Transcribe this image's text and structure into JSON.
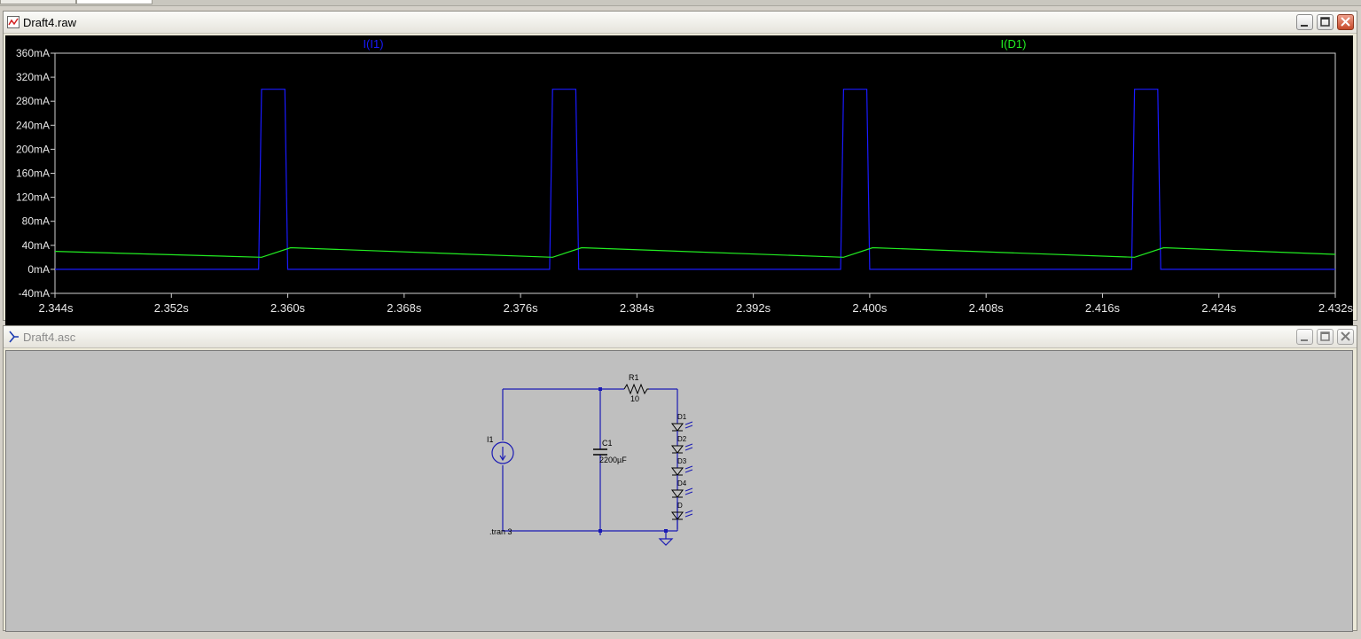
{
  "raw_window": {
    "title": "Draft4.raw",
    "icon": "waveform-icon",
    "traces": [
      {
        "name": "I(I1)",
        "color": "#1a1aff"
      },
      {
        "name": "I(D1)",
        "color": "#22ee22"
      }
    ]
  },
  "chart_data": {
    "type": "line",
    "x_unit": "s",
    "y_unit": "A",
    "xlim": [
      2.344,
      2.432
    ],
    "ylim": [
      -0.04,
      0.36
    ],
    "x_ticks": [
      "2.344s",
      "2.352s",
      "2.360s",
      "2.368s",
      "2.376s",
      "2.384s",
      "2.392s",
      "2.400s",
      "2.408s",
      "2.416s",
      "2.424s",
      "2.432s"
    ],
    "y_ticks": [
      "360mA",
      "320mA",
      "280mA",
      "240mA",
      "200mA",
      "160mA",
      "120mA",
      "80mA",
      "40mA",
      "0mA",
      "-40mA"
    ],
    "series": [
      {
        "name": "I(I1)",
        "color": "#1a1aff",
        "x": [
          2.344,
          2.358,
          2.3582,
          2.3598,
          2.36,
          2.378,
          2.3782,
          2.3798,
          2.38,
          2.398,
          2.3982,
          2.3998,
          2.4,
          2.418,
          2.4182,
          2.4198,
          2.42,
          2.432
        ],
        "y": [
          0,
          0,
          0.3,
          0.3,
          0,
          0,
          0.3,
          0.3,
          0,
          0,
          0.3,
          0.3,
          0,
          0,
          0.3,
          0.3,
          0,
          0
        ]
      },
      {
        "name": "I(D1)",
        "color": "#22ee22",
        "x": [
          2.344,
          2.3582,
          2.3602,
          2.3782,
          2.3802,
          2.3982,
          2.4002,
          2.4182,
          2.4202,
          2.432
        ],
        "y": [
          0.03,
          0.02,
          0.036,
          0.02,
          0.036,
          0.02,
          0.036,
          0.02,
          0.036,
          0.025
        ]
      }
    ]
  },
  "asc_window": {
    "title": "Draft4.asc",
    "icon": "schematic-icon",
    "components": {
      "resistor": {
        "ref": "R1",
        "value": "10"
      },
      "capacitor": {
        "ref": "C1",
        "value": "2200µF"
      },
      "source": {
        "ref": "I1"
      },
      "leds": [
        "D1",
        "D2",
        "D3",
        "D4",
        "D"
      ],
      "directive": ".tran 3"
    }
  }
}
